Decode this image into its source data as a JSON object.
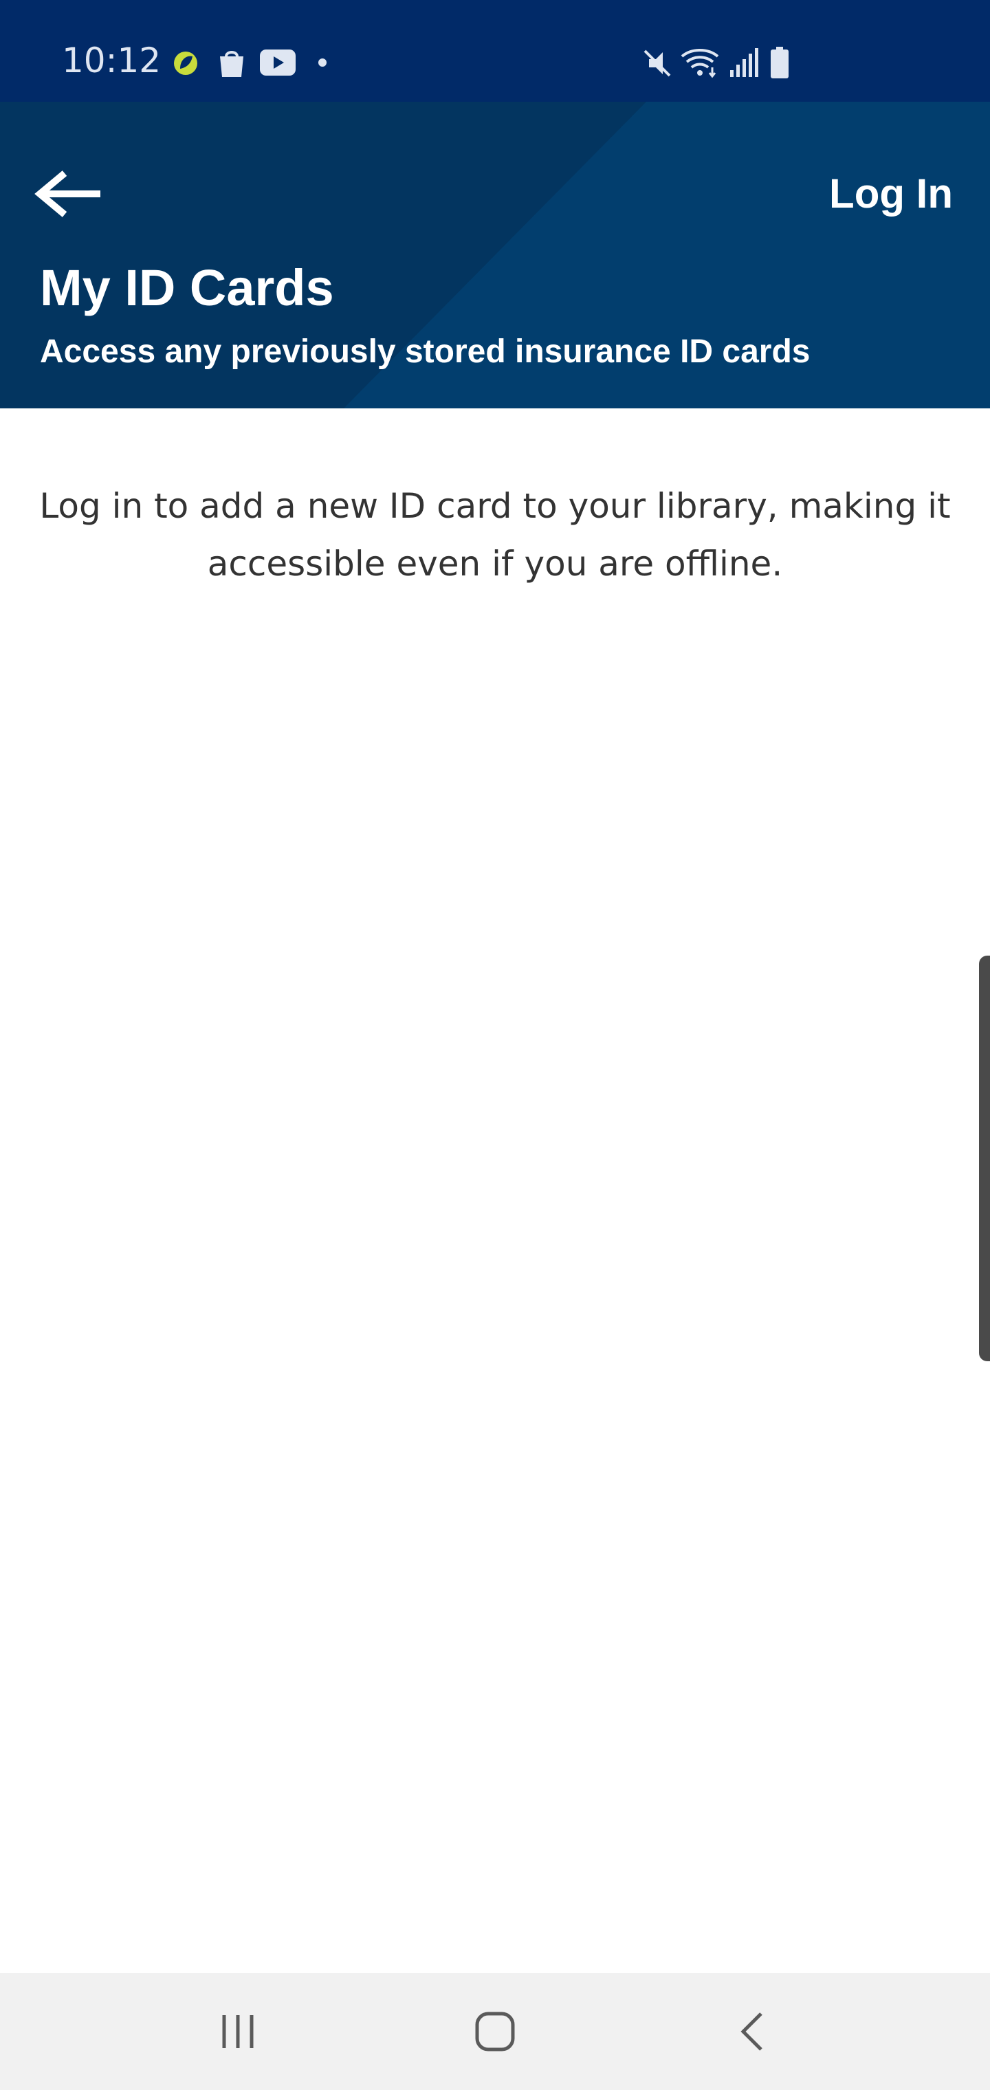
{
  "status_bar": {
    "time": "10:12",
    "left_icons": [
      "leaf-app-icon",
      "shopping-bag-icon",
      "youtube-icon",
      "dot-icon"
    ],
    "right_icons": [
      "mute-icon",
      "wifi-icon",
      "signal-icon",
      "battery-icon"
    ]
  },
  "header": {
    "back_icon": "arrow-left-icon",
    "login_label": "Log In",
    "title": "My ID Cards",
    "subtitle": "Access any previously stored insurance ID cards"
  },
  "main": {
    "message": "Log in to add a new ID card to your library, making it accessible even if you are offline."
  },
  "nav_bar": {
    "buttons": [
      "recent-apps-icon",
      "home-icon",
      "back-icon"
    ]
  },
  "colors": {
    "status_bar": "#012a68",
    "header": "#023e6e",
    "header_dark": "#033560",
    "text": "#333333",
    "nav_bar": "#f1f1f1"
  }
}
